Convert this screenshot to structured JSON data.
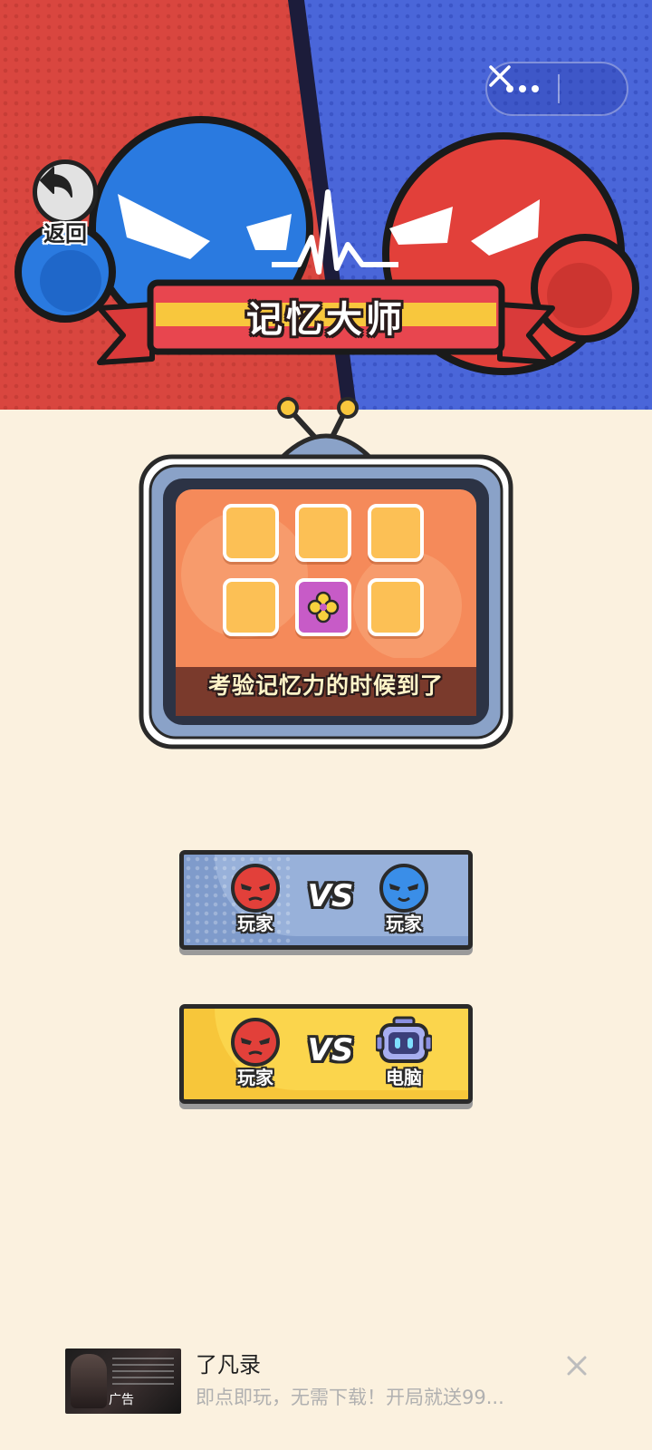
{
  "header": {
    "back_label": "返回",
    "title": "记忆大师"
  },
  "capsule": {
    "more_icon": "more-dots-icon",
    "close_icon": "close-icon"
  },
  "preview": {
    "caption": "考验记忆力的时候到了",
    "tiles": [
      "hidden",
      "hidden",
      "hidden",
      "hidden",
      "flower",
      "hidden"
    ]
  },
  "modes": {
    "pvp": {
      "left_label": "玩家",
      "vs": "VS",
      "right_label": "玩家"
    },
    "pve": {
      "left_label": "玩家",
      "vs": "VS",
      "right_label": "电脑"
    }
  },
  "ad": {
    "title": "了凡录",
    "description": "即点即玩，无需下载！开局就送99...",
    "tag": "广告"
  },
  "colors": {
    "background": "#fbf1df",
    "header_red": "#d9463f",
    "header_blue": "#4a66d9",
    "tile_yellow": "#fcc055",
    "pvp_button": "#7f9bcb",
    "pve_button": "#f7c63a"
  }
}
